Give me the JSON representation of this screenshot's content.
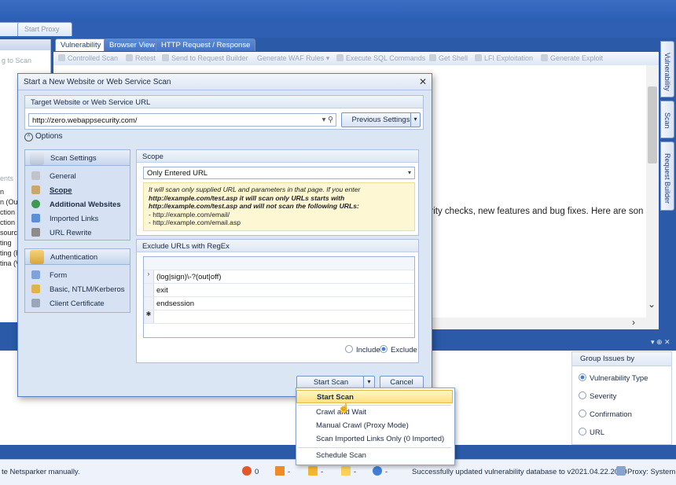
{
  "ribbon": {
    "tab_1": "Start Proxy"
  },
  "left_pane": {
    "title_frag": "g to Scan",
    "tabs_frag": "ents",
    "items": [
      "n",
      "n (Out",
      "ction",
      "ction (",
      "sourc",
      "ting",
      "ting (R",
      "tina (V"
    ]
  },
  "doc_tabs": [
    "Vulnerability",
    "Browser View",
    "HTTP Request / Response"
  ],
  "toolbar": [
    "Controlled Scan",
    "Retest",
    "Send to Request Builder",
    "Generate WAF Rules",
    "Execute SQL Commands",
    "Get Shell",
    "LFI Exploitation",
    "Generate Exploit"
  ],
  "doc_body_text": "urity checks, new features and bug fixes. Here are son",
  "right_tabs": [
    "Vulnerability",
    "Scan",
    "Request Builder"
  ],
  "dialog": {
    "title": "Start a New Website or Web Service Scan",
    "target_label": "Target Website or Web Service URL",
    "target_value": "http://zero.webappsecurity.com/",
    "previous_settings": "Previous Settings",
    "options_label": "Options",
    "nav": {
      "scan_settings": "Scan Settings",
      "scan_items": [
        "General",
        "Scope",
        "Additional Websites",
        "Imported Links",
        "URL Rewrite"
      ],
      "authentication": "Authentication",
      "auth_items": [
        "Form",
        "Basic, NTLM/Kerberos",
        "Client Certificate"
      ]
    },
    "scope": {
      "header": "Scope",
      "selected": "Only Entered URL",
      "info": [
        "It will scan only supplied URL and parameters in that page. If you enter",
        "http://example.com/test.asp it will scan only URLs starts with",
        "http://example.com/test.asp  and will not scan the following URLs:",
        " - http://example.com/email/",
        " - http://example.com/email.asp"
      ]
    },
    "exclude": {
      "header": "Exclude URLs with RegEx",
      "rows": [
        "(log|sign)\\-?(out|off)",
        "exit",
        "endsession",
        ""
      ],
      "include": "Include",
      "exclude": "Exclude"
    },
    "start_scan": "Start Scan",
    "cancel": "Cancel"
  },
  "menu": {
    "items": [
      "Start Scan",
      "Crawl and Wait",
      "Manual Crawl (Proxy Mode)",
      "Scan Imported Links Only (0 Imported)",
      "Schedule Scan"
    ]
  },
  "group_issues": {
    "header": "Group Issues by",
    "options": [
      "Vulnerability Type",
      "Severity",
      "Confirmation",
      "URL"
    ],
    "selected": "Vulnerability Type"
  },
  "status": {
    "left": "te Netsparker manually.",
    "counts": [
      "0",
      "-",
      "-",
      "-",
      "-"
    ],
    "message": "Successfully updated vulnerability database to v2021.04.22.2030",
    "proxy": "Proxy: System"
  },
  "colors": {
    "accent": "#2a5aa8",
    "highlight": "#ffe083",
    "info_bg": "#fdf7d4"
  }
}
